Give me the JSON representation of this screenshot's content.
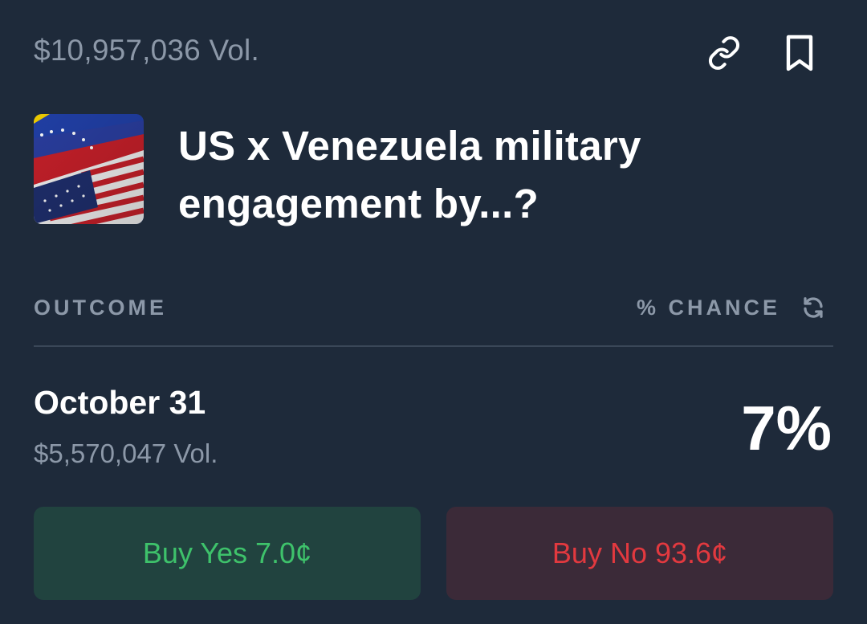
{
  "market": {
    "volume": "$10,957,036 Vol.",
    "title": "US x Venezuela military engagement by...?"
  },
  "icons": {
    "link": "link-icon",
    "bookmark": "bookmark-icon",
    "refresh": "refresh-icon"
  },
  "table": {
    "outcome_header": "OUTCOME",
    "chance_header": "% CHANCE"
  },
  "outcomes": [
    {
      "name": "October 31",
      "volume": "$5,570,047 Vol.",
      "chance": "7%",
      "buy_yes": "Buy Yes 7.0¢",
      "buy_no": "Buy No 93.6¢"
    }
  ],
  "colors": {
    "background": "#1e2a3a",
    "muted_text": "#8c98a8",
    "yes_green": "#3ec26b",
    "yes_bg": "#21433f",
    "no_red": "#e2393f",
    "no_bg": "#3b2a38"
  }
}
